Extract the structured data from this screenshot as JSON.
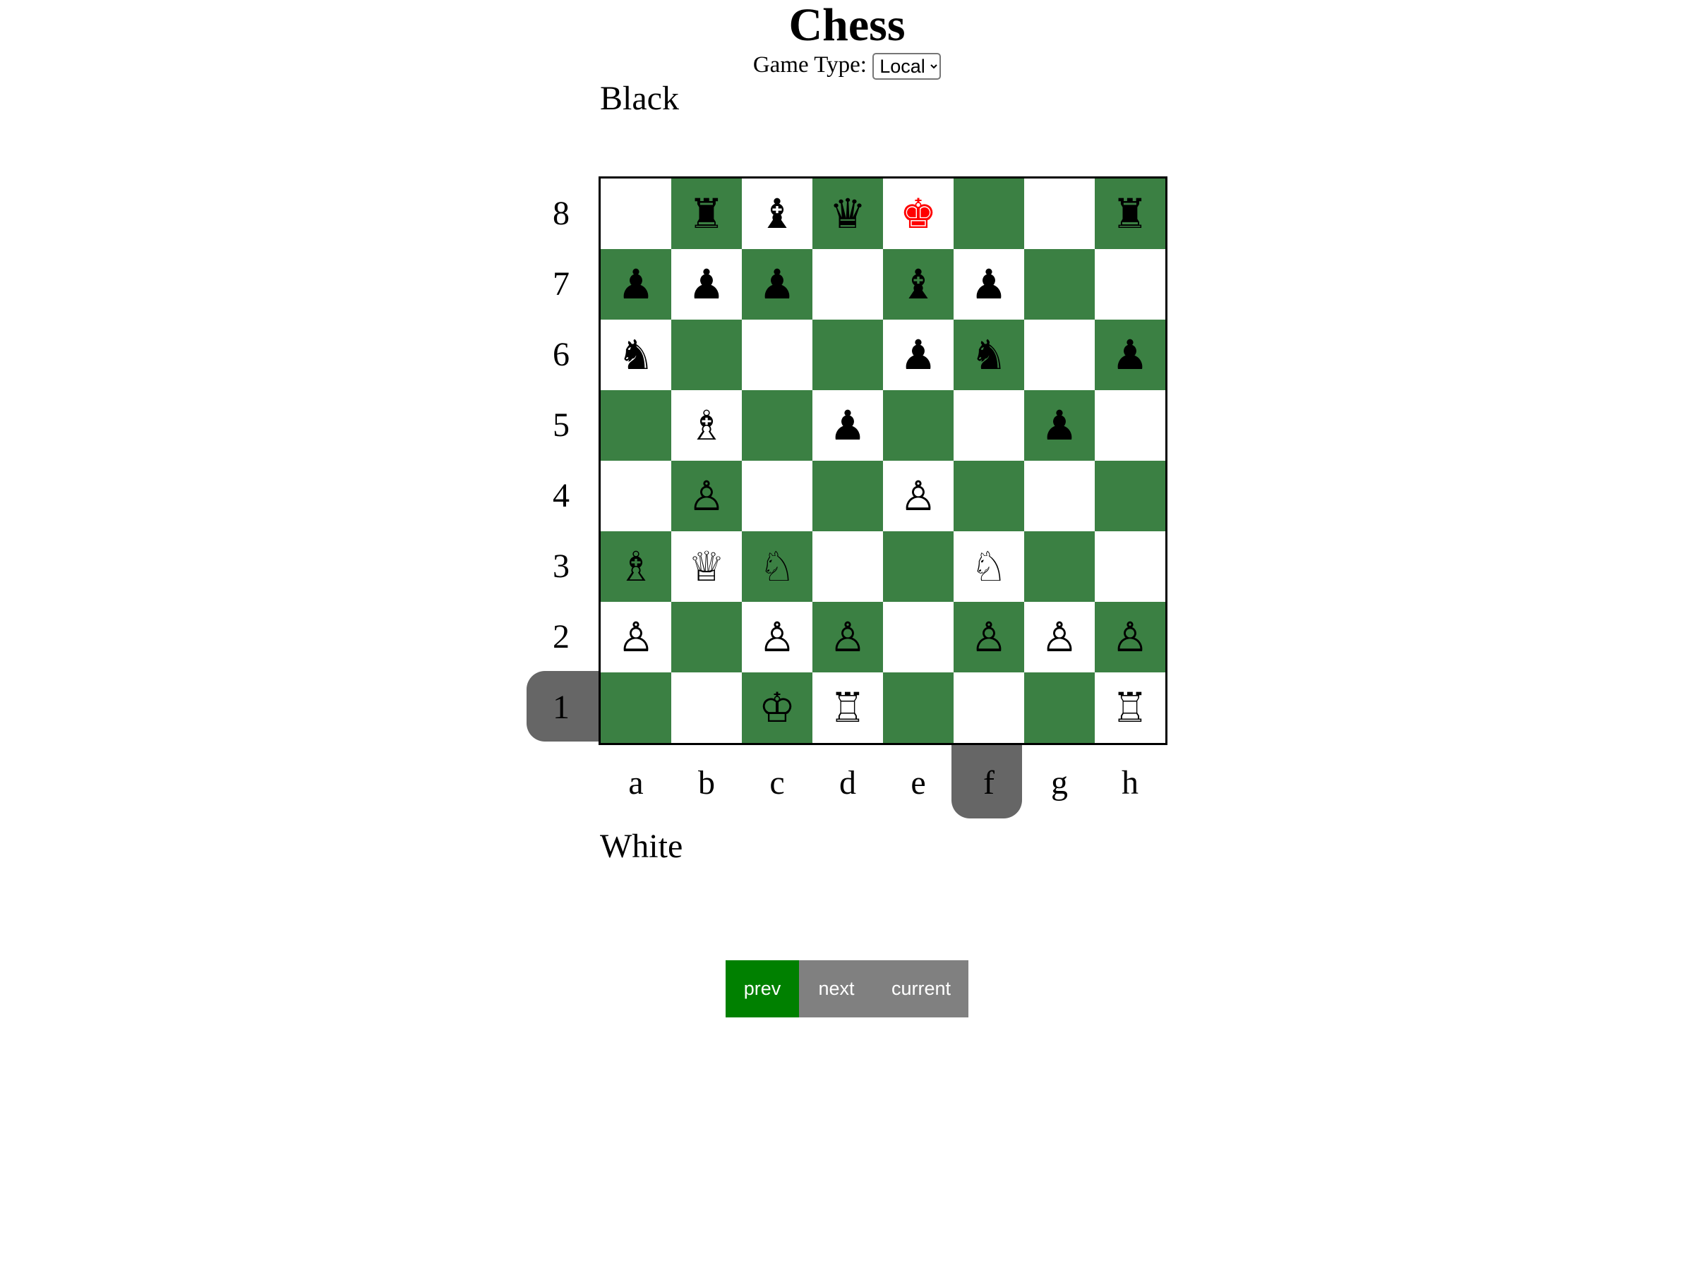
{
  "title": "Chess",
  "game_type": {
    "label": "Game Type:",
    "selected": "Local"
  },
  "players": {
    "top": "Black",
    "bottom": "White"
  },
  "board": {
    "colors": {
      "light": "#ffffff",
      "dark": "#3b8043",
      "in_check": "#ff0000",
      "highlight": "#666666"
    },
    "ranks": [
      "8",
      "7",
      "6",
      "5",
      "4",
      "3",
      "2",
      "1"
    ],
    "files": [
      "a",
      "b",
      "c",
      "d",
      "e",
      "f",
      "g",
      "h"
    ],
    "highlighted_rank": "1",
    "highlighted_file": "f",
    "rows": [
      [
        "",
        "♜",
        "♝",
        "♛",
        "♚",
        "",
        "",
        "♜"
      ],
      [
        "♟",
        "♟",
        "♟",
        "",
        "♝",
        "♟",
        "",
        ""
      ],
      [
        "♞",
        "",
        "",
        "",
        "♟",
        "♞",
        "",
        "♟"
      ],
      [
        "",
        "♗",
        "",
        "♟",
        "",
        "",
        "♟",
        ""
      ],
      [
        "",
        "♙",
        "",
        "",
        "♙",
        "",
        "",
        ""
      ],
      [
        "♗",
        "♕",
        "♘",
        "",
        "",
        "♘",
        "",
        ""
      ],
      [
        "♙",
        "",
        "♙",
        "♙",
        "",
        "♙",
        "♙",
        "♙"
      ],
      [
        "",
        "",
        "♔",
        "♖",
        "",
        "",
        "",
        "♖"
      ]
    ],
    "check_square": "e8"
  },
  "navigation": {
    "prev": "prev",
    "next": "next",
    "current": "current",
    "active": "prev",
    "active_color": "#008000",
    "inactive_color": "#808080"
  }
}
